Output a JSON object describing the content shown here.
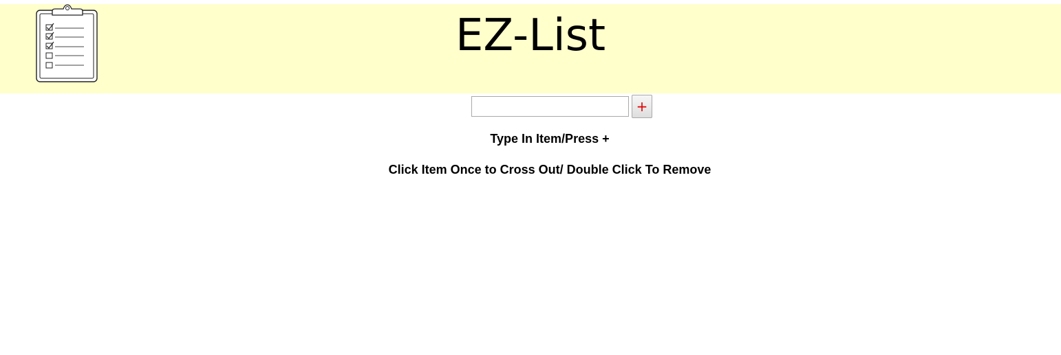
{
  "header": {
    "title": "EZ-List",
    "background_color": "#ffffcc",
    "logo_icon": "clipboard-checklist-icon"
  },
  "entry": {
    "input_value": "",
    "input_placeholder": "",
    "add_button_label": "+",
    "add_button_color": "#e00000"
  },
  "instructions": {
    "line1": "Type In Item/Press +",
    "line2": "Click Item Once to Cross Out/ Double Click To Remove"
  }
}
